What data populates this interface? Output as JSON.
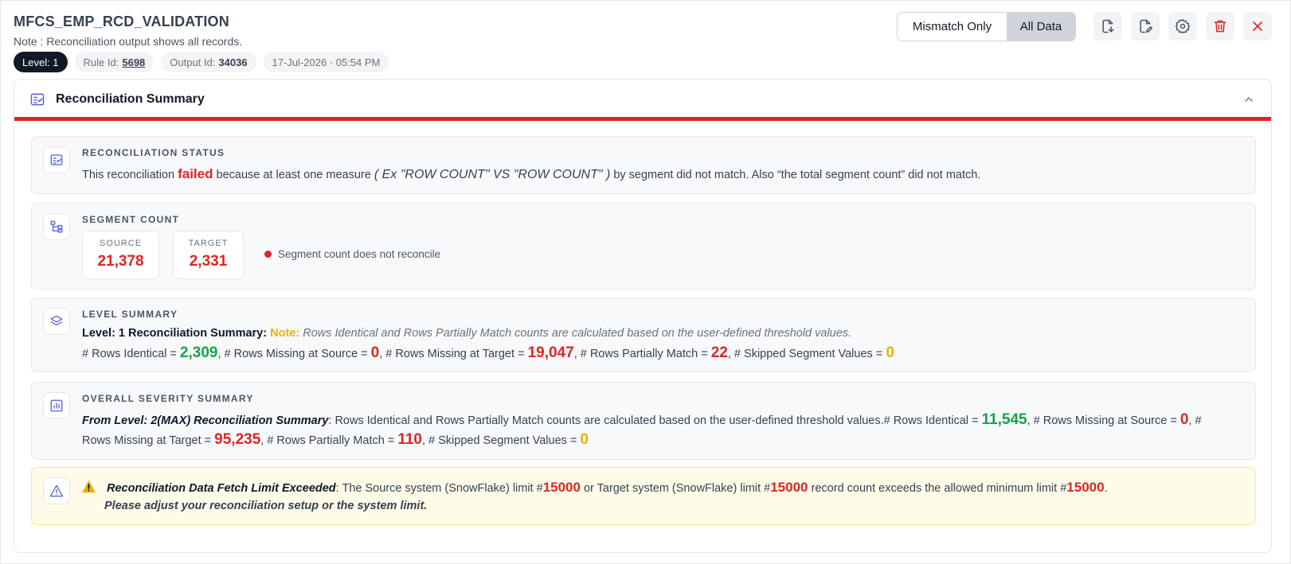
{
  "header": {
    "title": "MFCS_EMP_RCD_VALIDATION",
    "note": "Note : Reconciliation output shows all records.",
    "chips": {
      "level": "Level: 1",
      "rule_label": "Rule Id:",
      "rule_value": "5698",
      "output_label": "Output Id:",
      "output_value": "34036",
      "datetime": "17-Jul-2026 · 05:54 PM"
    },
    "toggle": {
      "mismatch_label": "Mismatch Only",
      "all_label": "All Data",
      "active": "All Data"
    },
    "toolbar_icons": [
      "download-file-icon",
      "edit-file-icon",
      "gear-icon",
      "trash-icon",
      "close-icon"
    ]
  },
  "summary": {
    "title": "Reconciliation Summary",
    "status": {
      "label": "RECONCILIATION STATUS",
      "t1": "This reconciliation ",
      "failed": "failed",
      "t2": " because at least one measure ",
      "measure": "( Ex \"ROW COUNT\" VS \"ROW COUNT\" )",
      "t3": " by segment did not match. Also “the total segment count” did not match."
    },
    "segment": {
      "label": "SEGMENT COUNT",
      "source_label": "SOURCE",
      "source_value": "21,378",
      "target_label": "TARGET",
      "target_value": "2,331",
      "message": "Segment count does not reconcile"
    },
    "level": {
      "label": "LEVEL SUMMARY",
      "heading": "Level: 1 Reconciliation Summary:",
      "note_label": "Note:",
      "note_text": "Rows Identical and Rows Partially Match counts are calculated based on the user-defined threshold values.",
      "identical_label": "# Rows Identical = ",
      "identical_value": "2,309",
      "missing_source_label": ", # Rows Missing at Source = ",
      "missing_source_value": "0",
      "missing_target_label": ", # Rows Missing at Target = ",
      "missing_target_value": "19,047",
      "partial_label": ", # Rows Partially Match = ",
      "partial_value": "22",
      "skipped_label": ", # Skipped Segment Values = ",
      "skipped_value": "0"
    },
    "overall": {
      "label": "OVERALL SEVERITY SUMMARY",
      "heading": "From Level: 2(MAX) Reconciliation Summary",
      "text": ": Rows Identical and Rows Partially Match counts are calculated based on the user-defined threshold values.",
      "identical_label": "# Rows Identical = ",
      "identical_value": "11,545",
      "missing_source_label": ", # Rows Missing at Source = ",
      "missing_source_value": "0",
      "missing_target_label": "Rows Missing at Target = ",
      "missing_target_value": "95,235",
      "partial_label": ", # Rows Partially Match = ",
      "partial_value": "110",
      "skipped_label": ", # Skipped Segment Values = ",
      "skipped_value": "0",
      "wrap_hash": ", #"
    },
    "warning": {
      "title": "Reconciliation Data Fetch Limit Exceeded",
      "t1": ": The Source system (SnowFlake) limit #",
      "v1": "15000",
      "t2": " or Target system (SnowFlake) limit #",
      "v2": "15000",
      "t3": " record count exceeds the allowed minimum limit #",
      "v3": "15000",
      "t4": ".",
      "advice": "Please adjust your reconciliation setup or the system limit."
    }
  },
  "colors": {
    "accent_red": "#dc2626",
    "green": "#16a34a",
    "amber": "#eab308",
    "icon_blue": "#4f5bd5"
  }
}
